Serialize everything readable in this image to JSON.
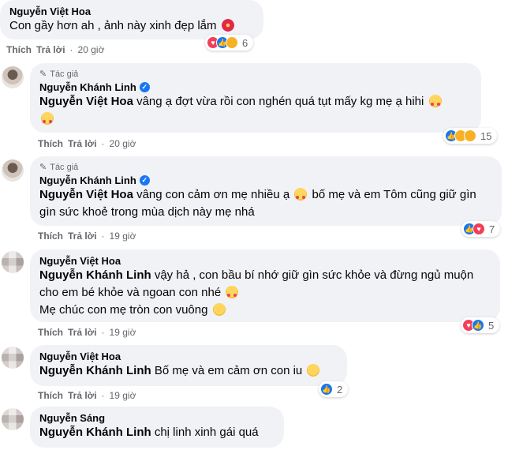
{
  "ui": {
    "like": "Thích",
    "reply": "Trả lời",
    "author_tag": "Tác giả"
  },
  "comments": [
    {
      "name": "Nguyễn Việt Hoa",
      "text": "Con gầy hơn ah , ảnh này xinh đẹp lắm",
      "time": "20 giờ",
      "reaction_count": "6",
      "reactions": [
        "love-icon",
        "like-icon",
        "haha-icon"
      ]
    },
    {
      "tag": "Tác giả",
      "name": "Nguyễn Khánh Linh",
      "mention": "Nguyễn Việt Hoa",
      "text": " vâng ạ đợt vừa rồi con nghén quá tụt mấy kg mẹ ạ hihi",
      "time": "20 giờ",
      "reaction_count": "15",
      "reactions": [
        "like-icon",
        "sad-icon",
        "haha-icon"
      ]
    },
    {
      "tag": "Tác giả",
      "name": "Nguyễn Khánh Linh",
      "mention": "Nguyễn Việt Hoa",
      "text": " vâng con cảm ơn mẹ nhiều ạ",
      "text2": " bố mẹ và em Tôm cũng giữ gìn gìn sức khoẻ trong mùa dịch này mẹ nhá",
      "time": "19 giờ",
      "reaction_count": "7",
      "reactions": [
        "like-icon",
        "love-icon"
      ]
    },
    {
      "name": "Nguyễn Việt Hoa",
      "mention": "Nguyễn Khánh Linh",
      "text": " vậy hả , con bầu bí nhớ giữ gìn sức khỏe và đừng ngủ muộn cho em bé khỏe và ngoan con nhé",
      "text2": "Mẹ chúc con mẹ tròn con vuông",
      "time": "19 giờ",
      "reaction_count": "5",
      "reactions": [
        "love-icon",
        "like-icon"
      ]
    },
    {
      "name": "Nguyễn Việt Hoa",
      "mention": "Nguyễn Khánh Linh",
      "text": " Bố mẹ và em cảm ơn con iu",
      "time": "19 giờ",
      "reaction_count": "2",
      "reactions": [
        "like-icon"
      ]
    },
    {
      "name": "Nguyễn Sáng",
      "mention": "Nguyễn Khánh Linh",
      "text": " chị linh xinh gái quá"
    }
  ],
  "colors": {
    "bubble": "#f0f2f5",
    "meta": "#65676b",
    "like": "#1877f2",
    "love": "#f33e58",
    "haha": "#f7b125"
  }
}
